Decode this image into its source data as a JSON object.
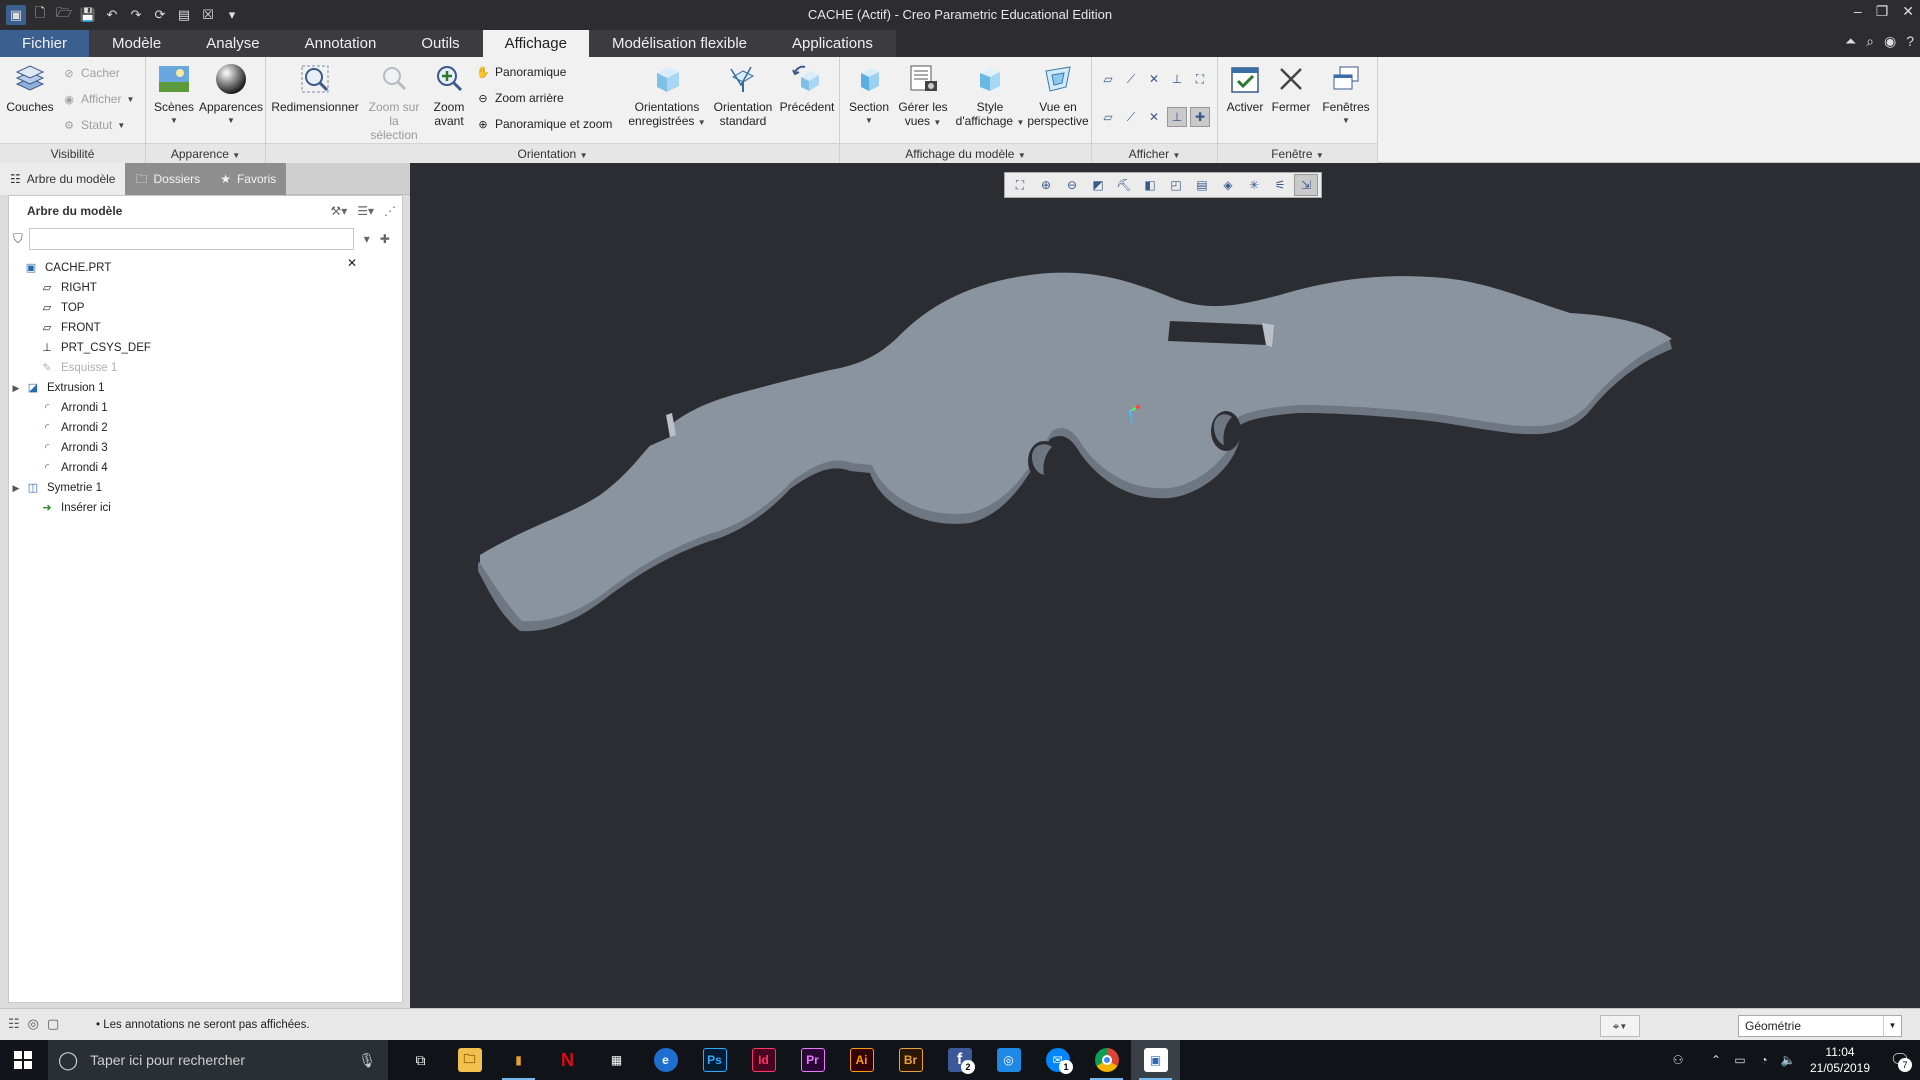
{
  "window": {
    "title": "CACHE (Actif) - Creo Parametric Educational Edition"
  },
  "tabs": [
    {
      "label": "Fichier"
    },
    {
      "label": "Modèle"
    },
    {
      "label": "Analyse"
    },
    {
      "label": "Annotation"
    },
    {
      "label": "Outils"
    },
    {
      "label": "Affichage"
    },
    {
      "label": "Modélisation flexible"
    },
    {
      "label": "Applications"
    }
  ],
  "ribbon": {
    "visibilite": {
      "label": "Visibilité",
      "couches": "Couches",
      "cacher": "Cacher",
      "afficher": "Afficher",
      "statut": "Statut"
    },
    "apparence": {
      "label": "Apparence",
      "scenes": "Scènes",
      "apparences": "Apparences"
    },
    "orientation": {
      "label": "Orientation",
      "redimensionner": "Redimensionner",
      "zoom_selection_1": "Zoom sur",
      "zoom_selection_2": "la sélection",
      "zoom_avant_1": "Zoom",
      "zoom_avant_2": "avant",
      "panoramique": "Panoramique",
      "zoom_arriere": "Zoom arrière",
      "panoramique_zoom": "Panoramique et zoom",
      "orient_enreg_1": "Orientations",
      "orient_enreg_2": "enregistrées",
      "orient_std_1": "Orientation",
      "orient_std_2": "standard",
      "precedent": "Précédent"
    },
    "affichage_modele": {
      "label": "Affichage du modèle",
      "section": "Section",
      "gerer_1": "Gérer les",
      "gerer_2": "vues",
      "style_1": "Style",
      "style_2": "d'affichage",
      "vue_1": "Vue en",
      "vue_2": "perspective"
    },
    "afficher": {
      "label": "Afficher"
    },
    "fenetre": {
      "label": "Fenêtre",
      "activer": "Activer",
      "fermer": "Fermer",
      "fenetres": "Fenêtres"
    }
  },
  "navigator": {
    "tabs": [
      {
        "label": "Arbre du modèle"
      },
      {
        "label": "Dossiers"
      },
      {
        "label": "Favoris"
      }
    ],
    "header": "Arbre du modèle",
    "search": {
      "value": "",
      "placeholder": ""
    },
    "tree": [
      {
        "label": "CACHE.PRT",
        "icon": "part-icon"
      },
      {
        "label": "RIGHT",
        "icon": "datum-plane-icon"
      },
      {
        "label": "TOP",
        "icon": "datum-plane-icon"
      },
      {
        "label": "FRONT",
        "icon": "datum-plane-icon"
      },
      {
        "label": "PRT_CSYS_DEF",
        "icon": "csys-icon"
      },
      {
        "label": "Esquisse 1",
        "icon": "sketch-icon"
      },
      {
        "label": "Extrusion 1",
        "icon": "extrude-icon"
      },
      {
        "label": "Arrondi 1",
        "icon": "round-icon"
      },
      {
        "label": "Arrondi 2",
        "icon": "round-icon"
      },
      {
        "label": "Arrondi 3",
        "icon": "round-icon"
      },
      {
        "label": "Arrondi 4",
        "icon": "round-icon"
      },
      {
        "label": "Symetrie 1",
        "icon": "mirror-icon"
      },
      {
        "label": "Insérer ici",
        "icon": "insert-arrow-icon"
      }
    ]
  },
  "status": {
    "message": "• Les annotations ne seront pas affichées.",
    "selection_filter": "Géométrie"
  },
  "taskbar": {
    "search_placeholder": "Taper ici pour rechercher",
    "time": "11:04",
    "date": "21/05/2019",
    "badges": {
      "facebook": "2",
      "messenger": "1",
      "notifications": "7"
    },
    "apps": {
      "ps": "Ps",
      "id": "Id",
      "pr": "Pr",
      "ai": "Ai",
      "br": "Br",
      "fb": "f"
    }
  },
  "colors": {
    "viewport_bg": "#2c2c33",
    "model_fill": "#8a949f",
    "model_side": "#6e7681",
    "ribbon_bg": "#f1f1f1"
  }
}
